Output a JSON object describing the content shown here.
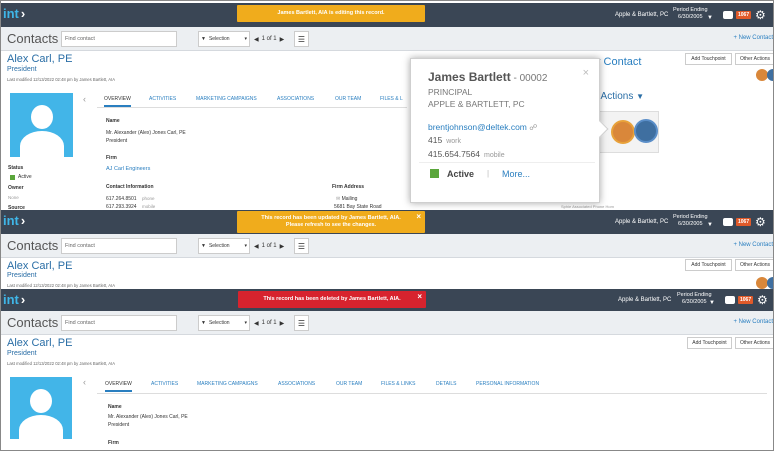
{
  "app": {
    "logo_text": "int",
    "logo_chevron": "›"
  },
  "colors": {
    "topbar": "#3a4655",
    "banner_warning": "#f0ac1c",
    "banner_error": "#d7232e",
    "link": "#2a7fc0",
    "avatar_bg": "#42b5e8",
    "status_green": "#5aa63b",
    "badge": "#e05a2a"
  },
  "header": {
    "company": "Apple & Bartlett, PC",
    "period_label": "Period Ending",
    "period_date": "6/30/2005",
    "badge_count": "1067",
    "chat_icon": "chat-icon",
    "settings_icon": "gear-icon"
  },
  "banners": {
    "editing": "James Bartlett, AIA is editing this record.",
    "updated": "This record has been updated by James Bartlett, AIA. Please refresh to see the changes.",
    "deleted": "This record has been deleted by James Bartlett, AIA."
  },
  "toolbar": {
    "title": "Contacts",
    "search_placeholder": "Find contact",
    "selection_label": "Selection",
    "page_of": "1 of 1",
    "new_contact": "+ New Contact"
  },
  "record": {
    "name": "Alex Carl, PE",
    "title": "President",
    "modified": "Last modified 12/13/2022 02:48 pm by James Bartlett, AIA",
    "add_touchpoint": "Add Touchpoint",
    "other_actions": "Other Actions"
  },
  "tabs": [
    "OVERVIEW",
    "ACTIVITIES",
    "MARKETING CAMPAIGNS",
    "ASSOCIATIONS",
    "OUR TEAM",
    "FILES & LINKS",
    "DETAILS",
    "PERSONAL INFORMATION"
  ],
  "tabs_top_visible": [
    "OVERVIEW",
    "ACTIVITIES",
    "MARKETING CAMPAIGNS",
    "ASSOCIATIONS",
    "OUR TEAM",
    "FILES & L"
  ],
  "overview": {
    "name_label": "Name",
    "full_name": "Mr. Alexander (Alex) Jones Carl, PE",
    "role": "President",
    "firm_label": "Firm",
    "firm_value": "AJ Carl Engineers",
    "contact_label": "Contact Information",
    "phone1": "617.264.8501",
    "phone1_type": "phone",
    "phone2": "617.293.3924",
    "phone2_type": "mobile",
    "firm_address_label": "Firm Address",
    "mailing": "Mailing",
    "address_line": "5681 Bay State Road",
    "status_label": "Status",
    "status_value": "Active",
    "owner_label": "Owner",
    "owner_value": "None",
    "source_label": "Source",
    "clipped_right": "Sphie Associated Phone Hom"
  },
  "popup": {
    "name": "James Bartlett",
    "id": " - 00002",
    "role": "PRINCIPAL",
    "company": "APPLE & BARTLETT, PC",
    "email": "brentjohnson@deltek.com",
    "phone_short": "415",
    "phone_short_type": "work",
    "phone_full": "415.654.7564",
    "phone_full_type": "mobile",
    "status": "Active",
    "sep": "|",
    "more": "More...",
    "close": "×",
    "behind_title": "v Contact",
    "behind_actions": "r Actions"
  }
}
